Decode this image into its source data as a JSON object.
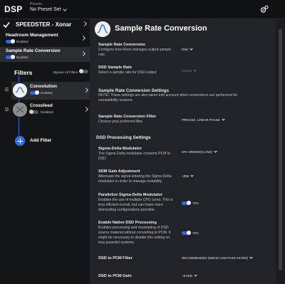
{
  "header": {
    "title": "DSP",
    "presets_label": "Presets",
    "preset_value": "No Preset Set"
  },
  "sidebar": {
    "device_name": "SPEEDSTER - Xonar",
    "items": [
      {
        "label": "Headroom Management",
        "state": "Enabled"
      },
      {
        "label": "Sample Rate Conversion",
        "state": "Enabled"
      }
    ],
    "filters_title": "Filters",
    "bypass_label": "Bypass All Filters",
    "filters": [
      {
        "name": "Convolution",
        "state": "Enabled"
      },
      {
        "name": "Crossfeed",
        "state": "Disabled"
      }
    ],
    "add_filter_label": "Add Filter"
  },
  "panel": {
    "title": "Sample Rate Conversion",
    "rows": {
      "src": {
        "title": "Sample Rate Conversion",
        "desc": "Configure how Roon manages output sample rate.",
        "value": "DSD"
      },
      "dsd_rate": {
        "title": "DSD Sample Rate",
        "desc": "Select a sample rate for DSD output",
        "value": "DSD64"
      },
      "src_settings": {
        "title": "Sample Rate Conversion Settings",
        "desc": "NOTE: These settings are also taken into account when conversions are performed for compatibility reasons."
      },
      "src_filter": {
        "title": "Sample Rate Conversion Filter",
        "desc": "Choose your preferred filter.",
        "value": "PRECISE, LINEAR PHASE"
      },
      "dsd_processing": {
        "title": "DSD Processing Settings"
      },
      "sdm": {
        "title": "Sigma-Delta Modulator",
        "desc": "The Sigma Delta modulator converts PCM to DSD",
        "value": "5TH ORDER(CLANS)"
      },
      "sdm_gain": {
        "title": "SDM Gain Adjustment",
        "desc": "Attenuate the signal entering the Sigma Delta modulator in order to manage instability.",
        "value": "-3DB"
      },
      "parallelize": {
        "title": "Parallelize Sigma-Delta Modulator",
        "desc": "Enables the use of multiple CPU cores. This is less efficient overall, but can make more demanding configurations possible.",
        "value": "YES"
      },
      "native_dsd": {
        "title": "Enable Native DSD Processing",
        "desc": "Enables processing and resampling of DSD source material without converting to PCM. It might be necessary to disable this setting on less powerful systems.",
        "value": "YES"
      },
      "dsd_to_pcm_filter": {
        "title": "DSD to PCM Filter",
        "value": "RECOMMENDED (30KHZ LOW PASS FILTER)"
      },
      "dsd_to_pcm_gain": {
        "title": "DSD to PCM Gain",
        "value": "+6.0DB"
      }
    }
  },
  "colors": {
    "accent": "#2c6ad8",
    "background": "#1b1c1e",
    "panel": "#222326",
    "sidebar": "#141517"
  }
}
